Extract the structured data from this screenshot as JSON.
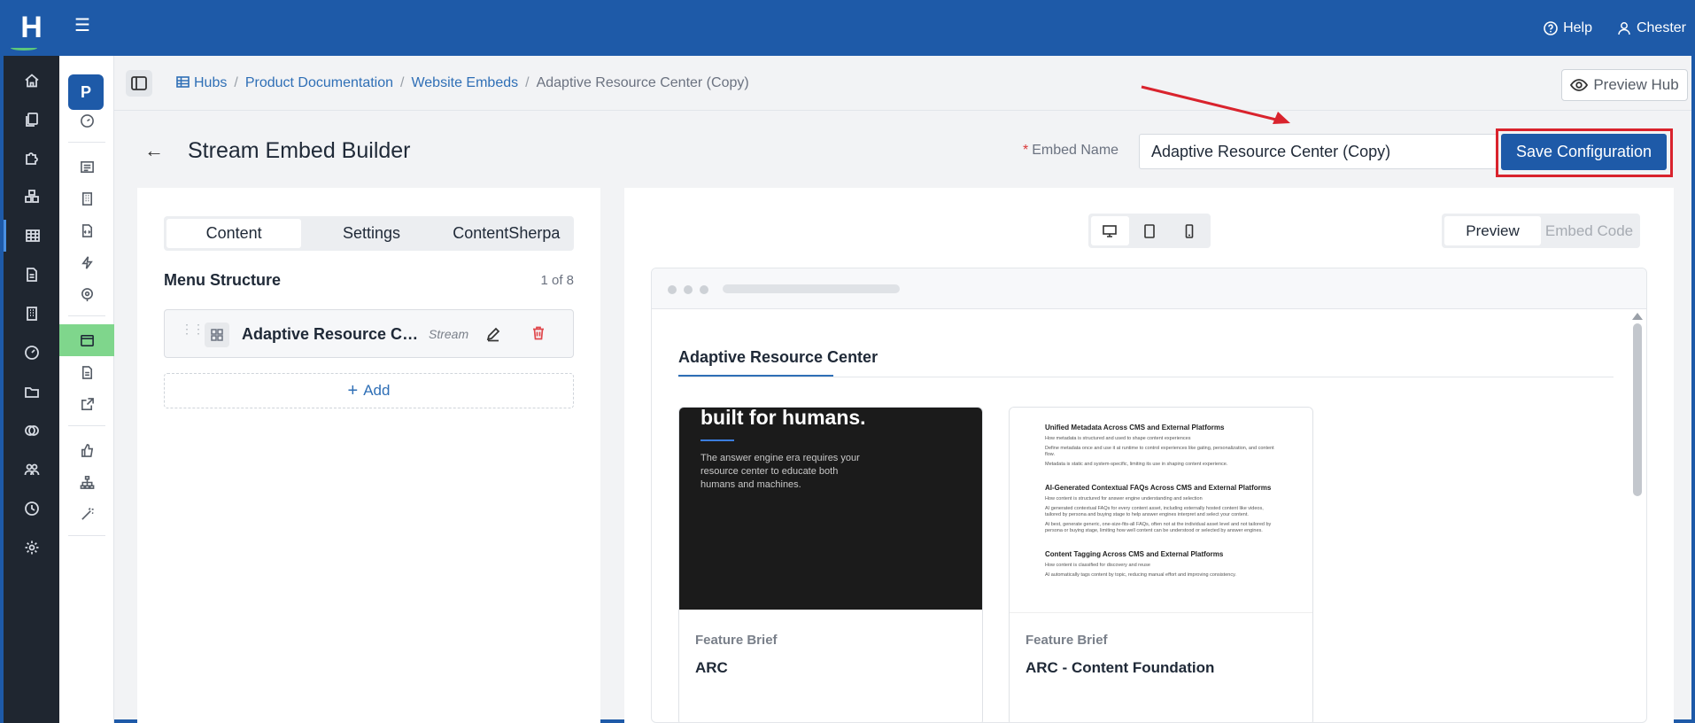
{
  "app": {
    "logo_letter": "H"
  },
  "topbar": {
    "help_label": "Help",
    "user_label": "Chester"
  },
  "rail2": {
    "badge": "P"
  },
  "breadcrumb": {
    "items": [
      "Hubs",
      "Product Documentation",
      "Website Embeds",
      "Adaptive Resource Center (Copy)"
    ],
    "preview_hub_label": "Preview Hub"
  },
  "header": {
    "title": "Stream Embed Builder",
    "embed_name_label": "Embed Name",
    "embed_name_value": "Adaptive Resource Center (Copy)",
    "save_label": "Save Configuration"
  },
  "left_panel": {
    "tabs": [
      "Content",
      "Settings",
      "ContentSherpa"
    ],
    "active_tab": "Content",
    "menu_title": "Menu Structure",
    "menu_count": "1 of 8",
    "items": [
      {
        "label": "Adaptive Resource Center",
        "type": "Stream"
      }
    ],
    "add_label": "Add"
  },
  "right_panel": {
    "view_tabs": [
      "Preview",
      "Embed Code"
    ],
    "active_view": "Preview",
    "preview": {
      "tab_label": "Adaptive Resource Center",
      "cards": [
        {
          "category": "Feature Brief",
          "title": "ARC",
          "thumb_heading": "built for humans.",
          "thumb_text": "The answer engine era requires your resource center to educate both humans and machines."
        },
        {
          "category": "Feature Brief",
          "title": "ARC - Content Foundation",
          "doc_sections": [
            {
              "heading": "Unified Metadata Across CMS and External Platforms",
              "lines": [
                "How metadata is structured and used to shape content experiences",
                "Define metadata once and use it at runtime to control experiences like gating, personalization, and content flow.",
                "Metadata is static and system-specific, limiting its use in shaping content experience."
              ]
            },
            {
              "heading": "AI-Generated Contextual FAQs Across CMS and External Platforms",
              "lines": [
                "How content is structured for answer engine understanding and selection",
                "AI generated contextual FAQs for every content asset, including externally hosted content like videos, tailored by persona and buying stage to help answer engines interpret and select your content.",
                "At best, generate generic, one-size-fits-all FAQs, often not at the individual asset level and not tailored by persona or buying stage, limiting how well content can be understood or selected by answer engines."
              ]
            },
            {
              "heading": "Content Tagging Across CMS and External Platforms",
              "lines": [
                "How content is classified for discovery and reuse",
                "AI automatically tags content by topic, reducing manual effort and improving consistency."
              ]
            }
          ]
        }
      ]
    }
  },
  "colors": {
    "brand_blue": "#1e5aa8",
    "highlight_red": "#d9232d",
    "active_green": "#7fd68c"
  }
}
